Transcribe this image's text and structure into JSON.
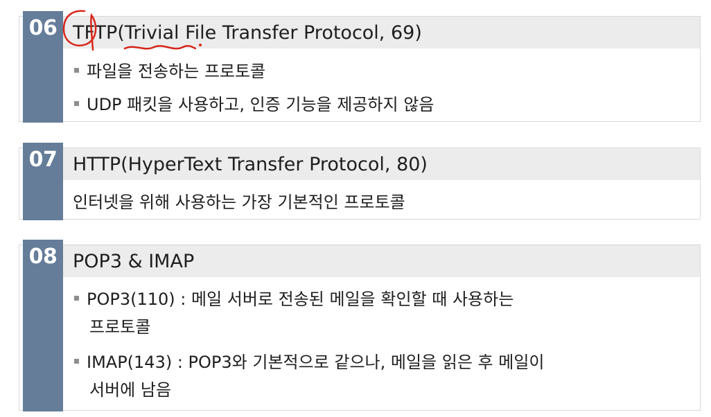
{
  "sections": [
    {
      "number": "06",
      "title": "TFTP(Trivial File Transfer Protocol, 69)",
      "bullets": [
        "파일을 전송하는 프로토콜",
        "UDP 패킷을 사용하고, 인증 기능을 제공하지 않음"
      ]
    },
    {
      "number": "07",
      "title": "HTTP(HyperText Transfer Protocol, 80)",
      "description": "인터넷을 위해 사용하는 가장 기본적인 프로토콜"
    },
    {
      "number": "08",
      "title": "POP3 & IMAP",
      "bullets": [
        {
          "line1": "POP3(110) : 메일 서버로 전송된 메일을 확인할 때 사용하는",
          "line2": "프로토콜"
        },
        {
          "line1": "IMAP(143) : POP3와 기본적으로 같으나, 메일을 읽은 후 메일이",
          "line2": "서버에 남음"
        }
      ]
    }
  ],
  "colors": {
    "number_bar": "#657d99",
    "header_band": "#ececec",
    "annotation": "#d7261b"
  }
}
